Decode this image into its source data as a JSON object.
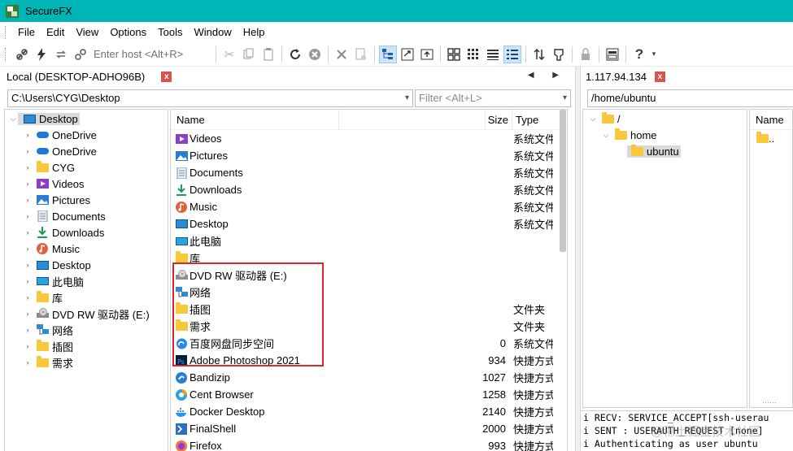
{
  "window": {
    "title": "SecureFX"
  },
  "menu": [
    "File",
    "Edit",
    "View",
    "Options",
    "Tools",
    "Window",
    "Help"
  ],
  "toolbar": {
    "host_placeholder": "Enter host <Alt+R>"
  },
  "local": {
    "tab_label": "Local (DESKTOP-ADHO96B)",
    "path": "C:\\Users\\CYG\\Desktop",
    "filter_placeholder": "Filter <Alt+L>",
    "tree": [
      {
        "label": "Desktop",
        "icon": "desktop-icon",
        "selected": true,
        "expanded": true,
        "level": 0
      },
      {
        "label": "OneDrive",
        "icon": "cloud-icon",
        "level": 1
      },
      {
        "label": "OneDrive",
        "icon": "cloud-icon",
        "level": 1
      },
      {
        "label": "CYG",
        "icon": "folder-icon",
        "level": 1
      },
      {
        "label": "Videos",
        "icon": "videos-icon",
        "level": 1
      },
      {
        "label": "Pictures",
        "icon": "pictures-icon",
        "level": 1
      },
      {
        "label": "Documents",
        "icon": "documents-icon",
        "level": 1
      },
      {
        "label": "Downloads",
        "icon": "downloads-icon",
        "level": 1
      },
      {
        "label": "Music",
        "icon": "music-icon",
        "level": 1
      },
      {
        "label": "Desktop",
        "icon": "desktop-icon",
        "level": 1
      },
      {
        "label": "此电脑",
        "icon": "computer-icon",
        "level": 1
      },
      {
        "label": "库",
        "icon": "folder-icon",
        "level": 1
      },
      {
        "label": "DVD RW 驱动器 (E:)",
        "icon": "dvd-drive-icon",
        "level": 1
      },
      {
        "label": "网络",
        "icon": "network-icon",
        "level": 1
      },
      {
        "label": "插图",
        "icon": "folder-icon",
        "level": 1
      },
      {
        "label": "需求",
        "icon": "folder-icon",
        "level": 1
      }
    ],
    "columns": {
      "name": "Name",
      "size": "Size",
      "type": "Type"
    },
    "files": [
      {
        "name": "Videos",
        "size": "",
        "type": "系统文件夹",
        "icon": "videos-icon"
      },
      {
        "name": "Pictures",
        "size": "",
        "type": "系统文件夹",
        "icon": "pictures-icon"
      },
      {
        "name": "Documents",
        "size": "",
        "type": "系统文件夹",
        "icon": "documents-icon"
      },
      {
        "name": "Downloads",
        "size": "",
        "type": "系统文件夹",
        "icon": "downloads-icon"
      },
      {
        "name": "Music",
        "size": "",
        "type": "系统文件夹",
        "icon": "music-icon"
      },
      {
        "name": "Desktop",
        "size": "",
        "type": "系统文件夹",
        "icon": "desktop-icon"
      },
      {
        "name": "此电脑",
        "size": "",
        "type": "",
        "icon": "computer-icon"
      },
      {
        "name": "库",
        "size": "",
        "type": "",
        "icon": "folder-icon"
      },
      {
        "name": "DVD RW 驱动器 (E:)",
        "size": "",
        "type": "",
        "icon": "dvd-drive-icon"
      },
      {
        "name": "网络",
        "size": "",
        "type": "",
        "icon": "network-icon"
      },
      {
        "name": "插图",
        "size": "",
        "type": "文件夹",
        "icon": "folder-icon"
      },
      {
        "name": "需求",
        "size": "",
        "type": "文件夹",
        "icon": "folder-icon"
      },
      {
        "name": "百度网盘同步空间",
        "size": "0",
        "type": "系统文件夹",
        "icon": "baidu-netdisk-icon"
      },
      {
        "name": "Adobe Photoshop 2021",
        "size": "934",
        "type": "快捷方式",
        "icon": "photoshop-icon"
      },
      {
        "name": "Bandizip",
        "size": "1027",
        "type": "快捷方式",
        "icon": "bandizip-icon"
      },
      {
        "name": "Cent Browser",
        "size": "1258",
        "type": "快捷方式",
        "icon": "cent-browser-icon"
      },
      {
        "name": "Docker Desktop",
        "size": "2140",
        "type": "快捷方式",
        "icon": "docker-icon"
      },
      {
        "name": "FinalShell",
        "size": "2000",
        "type": "快捷方式",
        "icon": "finalshell-icon"
      },
      {
        "name": "Firefox",
        "size": "993",
        "type": "快捷方式",
        "icon": "firefox-icon"
      }
    ]
  },
  "remote": {
    "tab_label": "1.117.94.134",
    "path": "/home/ubuntu",
    "tree": [
      {
        "label": "/",
        "level": 0
      },
      {
        "label": "home",
        "level": 1
      },
      {
        "label": "ubuntu",
        "level": 2,
        "selected": true
      }
    ],
    "list_header": "Name",
    "list_items": [
      ".."
    ]
  },
  "log": [
    "i RECV: SERVICE_ACCEPT[ssh-userau",
    "i SENT : USERAUTH_REQUEST [none]",
    "i Authenticating as user ubuntu"
  ],
  "watermark": "@稀土掘金技术社区",
  "colors": {
    "titlebar": "#00b5b5",
    "highlight_box": "#d9262c",
    "selection": "#d9d9d9"
  }
}
